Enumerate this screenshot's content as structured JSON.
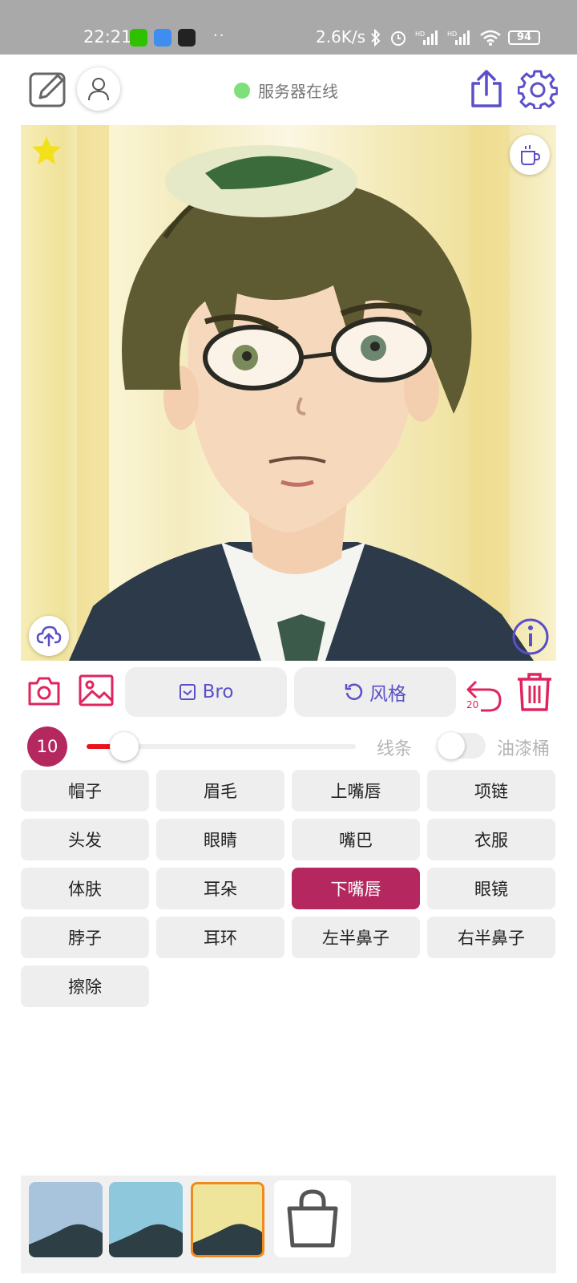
{
  "status_bar": {
    "time": "22:21",
    "dots": "··",
    "net_speed": "2.6K/s",
    "battery": "94"
  },
  "toolbar": {
    "server_status": "服务器在线",
    "status_color": "#7ee07a",
    "accent": "#5a4fc8"
  },
  "actions": {
    "bro_label": "Bro",
    "style_label": "风格",
    "undo_count": "20"
  },
  "brush": {
    "size": "10",
    "slider_fraction": 0.14,
    "line_label": "线条",
    "bucket_label": "油漆桶",
    "bucket_toggle_on": false
  },
  "parts": [
    {
      "label": "帽子"
    },
    {
      "label": "眉毛"
    },
    {
      "label": "上嘴唇"
    },
    {
      "label": "项链"
    },
    {
      "label": "头发"
    },
    {
      "label": "眼睛"
    },
    {
      "label": "嘴巴"
    },
    {
      "label": "衣服"
    },
    {
      "label": "体肤"
    },
    {
      "label": "耳朵"
    },
    {
      "label": "下嘴唇",
      "selected": true
    },
    {
      "label": "眼镜"
    },
    {
      "label": "脖子"
    },
    {
      "label": "耳环"
    },
    {
      "label": "左半鼻子"
    },
    {
      "label": "右半鼻子"
    },
    {
      "label": "擦除"
    }
  ],
  "colors": {
    "selected": "#b5275f",
    "danger": "#e0245e",
    "button_bg": "#eeeeee"
  },
  "thumbnails": [
    {
      "sky": "#a8c4dc",
      "selected": false
    },
    {
      "sky": "#8ec8dc",
      "selected": false
    },
    {
      "sky": "#efe59a",
      "selected": true
    }
  ]
}
